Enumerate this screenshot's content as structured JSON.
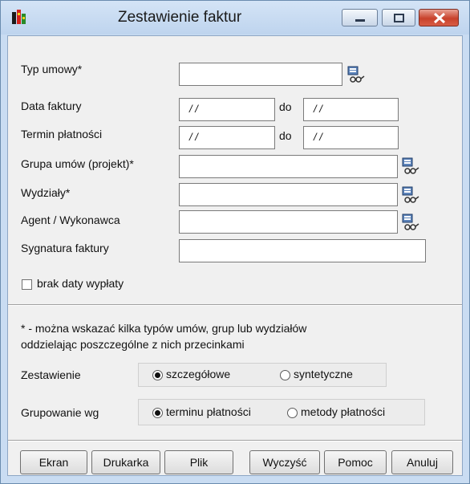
{
  "window": {
    "title": "Zestawienie faktur"
  },
  "form": {
    "typ_umowy_label": "Typ umowy*",
    "data_faktury_label": "Data faktury",
    "termin_platnosci_label": "Termin płatności",
    "grupa_umow_label": "Grupa umów (projekt)*",
    "wydzialy_label": "Wydziały*",
    "agent_label": "Agent / Wykonawca",
    "sygnatura_label": "Sygnatura faktury",
    "do_label": "do",
    "date_placeholder": "/ /",
    "brak_daty_label": "brak daty wypłaty",
    "note_line1": "* - można wskazać kilka typów umów, grup lub wydziałów",
    "note_line2": "oddzielając poszczególne z nich przecinkami"
  },
  "zestawienie": {
    "label": "Zestawienie",
    "options": [
      "szczegółowe",
      "syntetyczne"
    ],
    "selected": "szczegółowe"
  },
  "grupowanie": {
    "label": "Grupowanie wg",
    "options": [
      "terminu płatności",
      "metody płatności"
    ],
    "selected": "terminu płatności"
  },
  "buttons": {
    "ekran": "Ekran",
    "drukarka": "Drukarka",
    "plik": "Plik",
    "wyczysc": "Wyczyść",
    "pomoc": "Pomoc",
    "anuluj": "Anuluj"
  },
  "colors": {
    "titlebar": "#c9dcf2",
    "close": "#c8412b",
    "client": "#f0f0f0"
  }
}
